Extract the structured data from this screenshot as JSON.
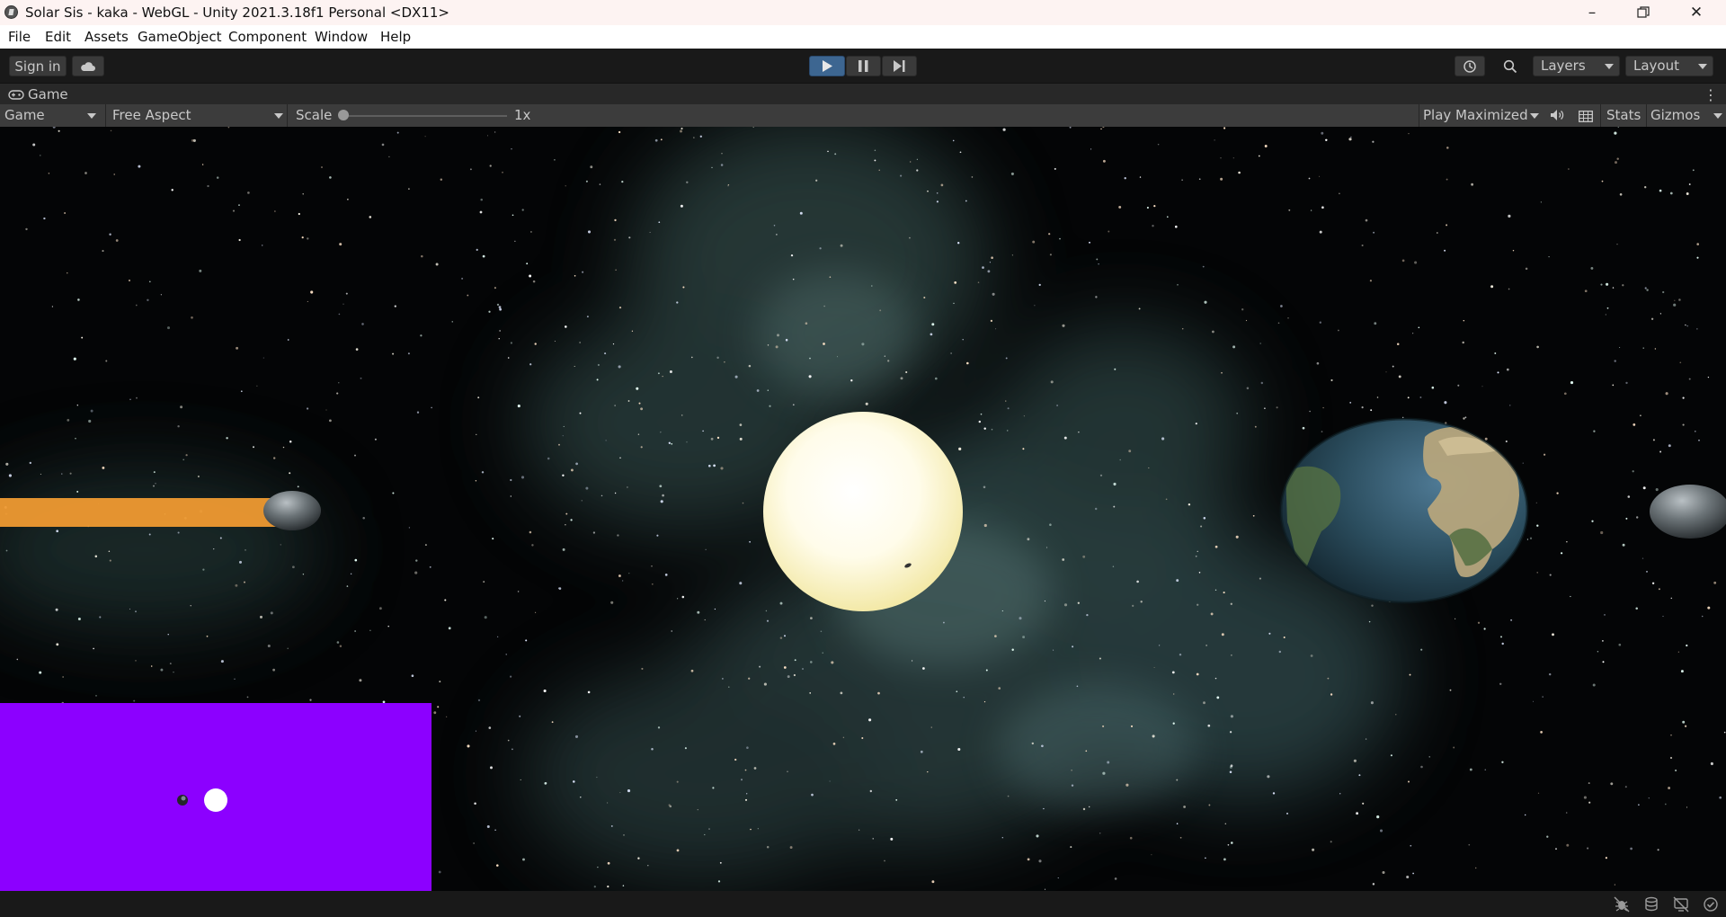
{
  "window": {
    "title": "Solar Sis - kaka - WebGL - Unity 2021.3.18f1 Personal <DX11>",
    "controls": [
      "minimize-icon",
      "restore-icon",
      "close-icon"
    ]
  },
  "menu": {
    "items": [
      "File",
      "Edit",
      "Assets",
      "GameObject",
      "Component",
      "Window",
      "Help"
    ]
  },
  "toolbar": {
    "sign_in": "Sign in",
    "layers": "Layers",
    "layout": "Layout",
    "play_state": "playing"
  },
  "game_tab": {
    "label": "Game"
  },
  "game_toolbar": {
    "display": "Game",
    "aspect": "Free Aspect",
    "scale_label": "Scale",
    "scale_value": "1x",
    "scale_fraction": 0.0,
    "play_mode": "Play Maximized",
    "stats": "Stats",
    "gizmos": "Gizmos"
  },
  "scene": {
    "background_color": "#040506",
    "minimap_color": "#8c00ff",
    "trail_color": "#ef9a32",
    "objects": [
      "sun",
      "earth",
      "moon",
      "asteroid",
      "orange-trail",
      "minimap"
    ]
  },
  "colors": {
    "play_active": "#3d6691",
    "toolbar_bg": "#191919",
    "panel_bg": "#3c3c3c"
  }
}
